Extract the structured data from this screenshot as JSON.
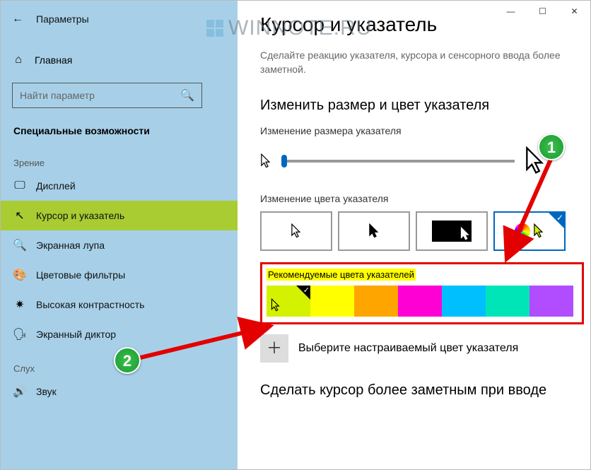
{
  "window": {
    "title": "Параметры"
  },
  "sidebar": {
    "home": "Главная",
    "search_placeholder": "Найти параметр",
    "category": "Специальные возможности",
    "group_vision": "Зрение",
    "group_hearing": "Слух",
    "items_vision": [
      {
        "icon": "display-icon",
        "label": "Дисплей"
      },
      {
        "icon": "cursor-icon",
        "label": "Курсор и указатель"
      },
      {
        "icon": "magnifier-icon",
        "label": "Экранная лупа"
      },
      {
        "icon": "palette-icon",
        "label": "Цветовые фильтры"
      },
      {
        "icon": "contrast-icon",
        "label": "Высокая контрастность"
      },
      {
        "icon": "narrator-icon",
        "label": "Экранный диктор"
      }
    ],
    "items_hearing": [
      {
        "icon": "sound-icon",
        "label": "Звук"
      }
    ]
  },
  "main": {
    "title": "Курсор и указатель",
    "desc": "Сделайте реакцию указателя, курсора и сенсорного ввода более заметной.",
    "section_size": "Изменить размер и цвет указателя",
    "sub_size": "Изменение размера указателя",
    "sub_color": "Изменение цвета указателя",
    "rec_label": "Рекомендуемые цвета указателей",
    "add_custom": "Выберите настраиваемый цвет указателя",
    "make_visible": "Сделать курсор более заметным при вводе"
  },
  "swatches": [
    {
      "color": "#d4f200",
      "selected": true
    },
    {
      "color": "#ffff00"
    },
    {
      "color": "#ffa500"
    },
    {
      "color": "#ff00d4"
    },
    {
      "color": "#00bfff"
    },
    {
      "color": "#00e5b8"
    },
    {
      "color": "#b24dff"
    }
  ],
  "badges": {
    "one": "1",
    "two": "2"
  },
  "watermark": "WINNOTE.RU"
}
